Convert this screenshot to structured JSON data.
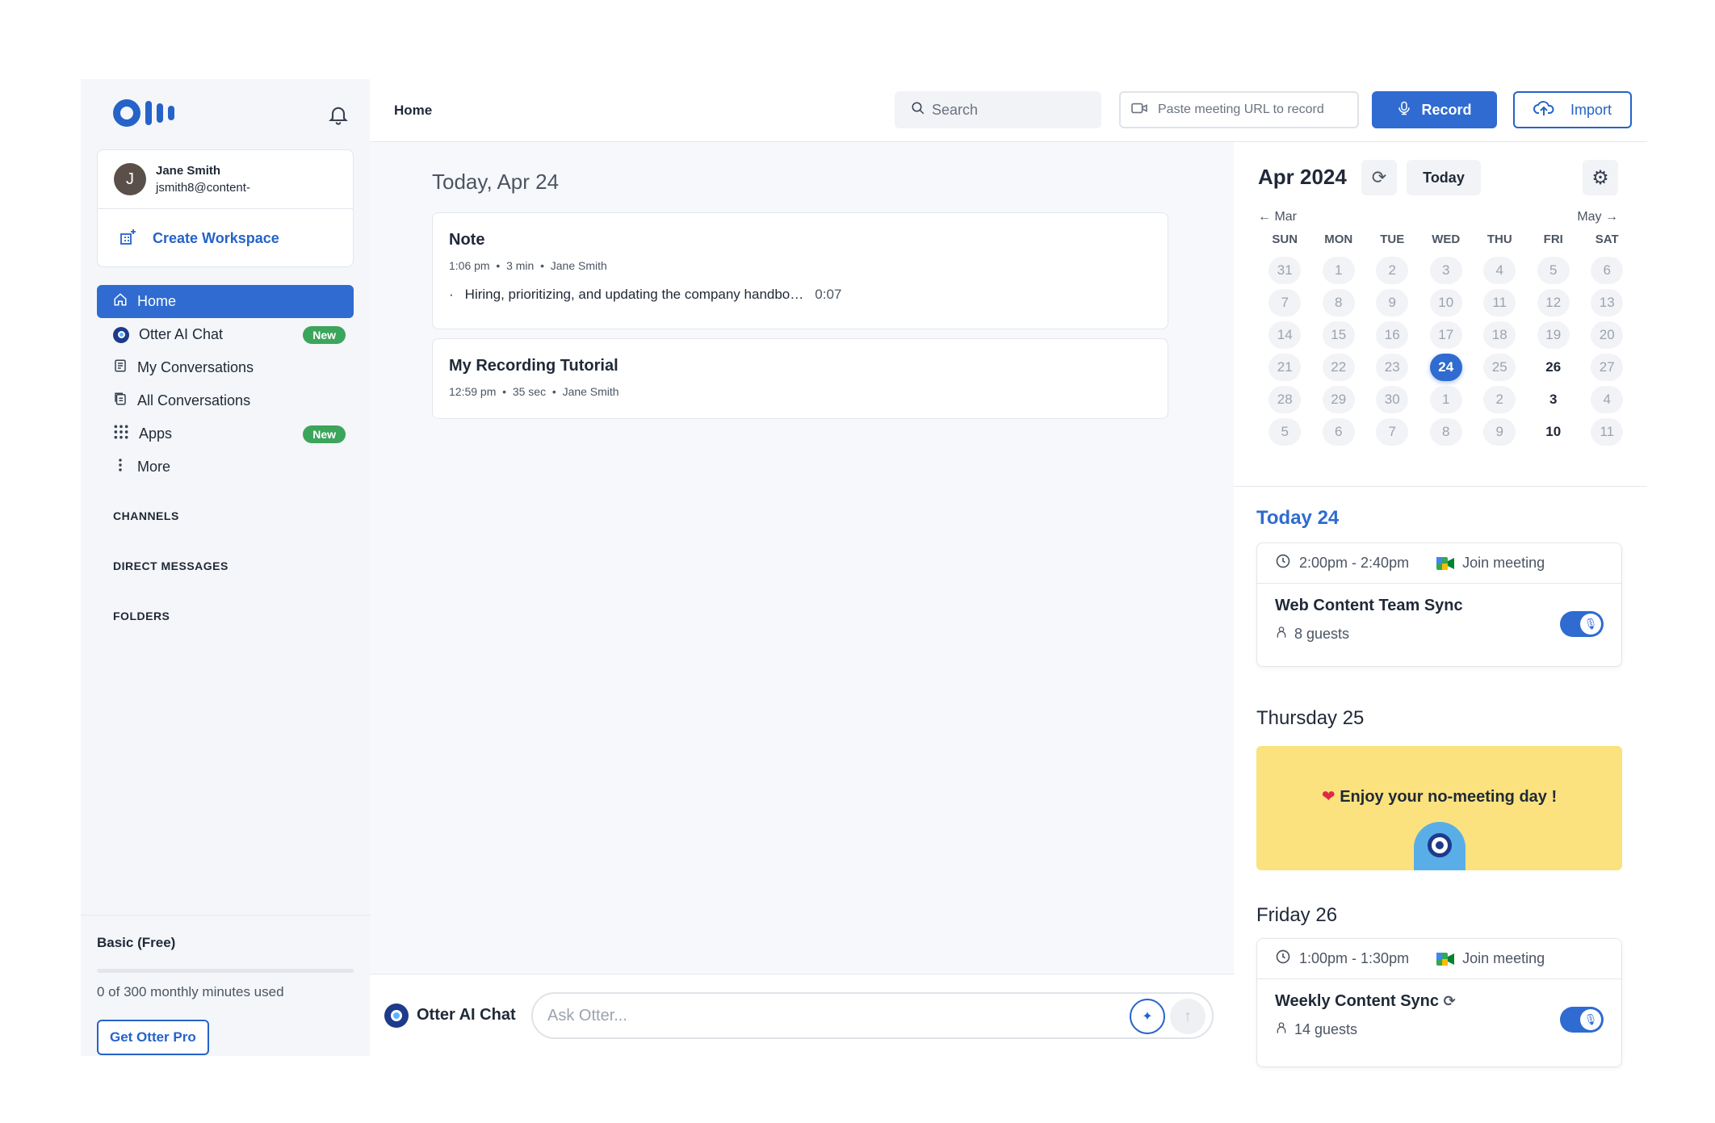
{
  "colors": {
    "accent": "#2f6bd0",
    "badge": "#3ba55c",
    "promo": "#fbe27e"
  },
  "sidebar": {
    "user": {
      "initial": "J",
      "name": "Jane Smith",
      "email": "jsmith8@content-"
    },
    "workspace_label": "Create Workspace",
    "items": [
      {
        "label": "Home",
        "icon": "home-icon",
        "active": true
      },
      {
        "label": "Otter AI Chat",
        "icon": "otter-icon",
        "badge": "New"
      },
      {
        "label": "My Conversations",
        "icon": "document-icon"
      },
      {
        "label": "All Conversations",
        "icon": "documents-icon"
      },
      {
        "label": "Apps",
        "icon": "grid-icon",
        "badge": "New"
      },
      {
        "label": "More",
        "icon": "kebab-icon"
      }
    ],
    "sections": [
      "CHANNELS",
      "DIRECT MESSAGES",
      "FOLDERS"
    ],
    "plan": {
      "title": "Basic (Free)",
      "usage": "0 of 300 monthly minutes used",
      "progress": 0,
      "cta": "Get Otter Pro"
    }
  },
  "header": {
    "breadcrumb": "Home",
    "search_placeholder": "Search",
    "url_placeholder": "Paste meeting URL to record",
    "record_label": "Record",
    "import_label": "Import"
  },
  "feed": {
    "date_heading": "Today, Apr 24",
    "cards": [
      {
        "title": "Note",
        "time": "1:06 pm",
        "duration": "3 min",
        "owner": "Jane Smith",
        "snippet": "Hiring, prioritizing, and updating the company handbo…",
        "snippet_time": "0:07"
      },
      {
        "title": "My Recording Tutorial",
        "time": "12:59 pm",
        "duration": "35 sec",
        "owner": "Jane Smith"
      }
    ]
  },
  "chat": {
    "label": "Otter AI Chat",
    "placeholder": "Ask Otter..."
  },
  "calendar": {
    "title": "Apr 2024",
    "today_label": "Today",
    "prev": "Mar",
    "next": "May",
    "weekdays": [
      "SUN",
      "MON",
      "TUE",
      "WED",
      "THU",
      "FRI",
      "SAT"
    ],
    "weeks": [
      [
        "31",
        "1",
        "2",
        "3",
        "4",
        "5",
        "6"
      ],
      [
        "7",
        "8",
        "9",
        "10",
        "11",
        "12",
        "13"
      ],
      [
        "14",
        "15",
        "16",
        "17",
        "18",
        "19",
        "20"
      ],
      [
        "21",
        "22",
        "23",
        "24",
        "25",
        "26",
        "27"
      ],
      [
        "28",
        "29",
        "30",
        "1",
        "2",
        "3",
        "4"
      ],
      [
        "5",
        "6",
        "7",
        "8",
        "9",
        "10",
        "11"
      ]
    ],
    "selected": "3-3",
    "free_days": [
      "3-5",
      "4-5",
      "5-5"
    ]
  },
  "agenda": {
    "today_heading": "Today 24",
    "event1": {
      "time": "2:00pm - 2:40pm",
      "join": "Join meeting",
      "title": "Web Content Team Sync",
      "guests": "8 guests"
    },
    "thursday_heading": "Thursday 25",
    "no_meeting": "Enjoy your no-meeting day !",
    "friday_heading": "Friday 26",
    "event2": {
      "time": "1:00pm - 1:30pm",
      "join": "Join meeting",
      "title": "Weekly Content Sync",
      "guests": "14 guests"
    }
  }
}
